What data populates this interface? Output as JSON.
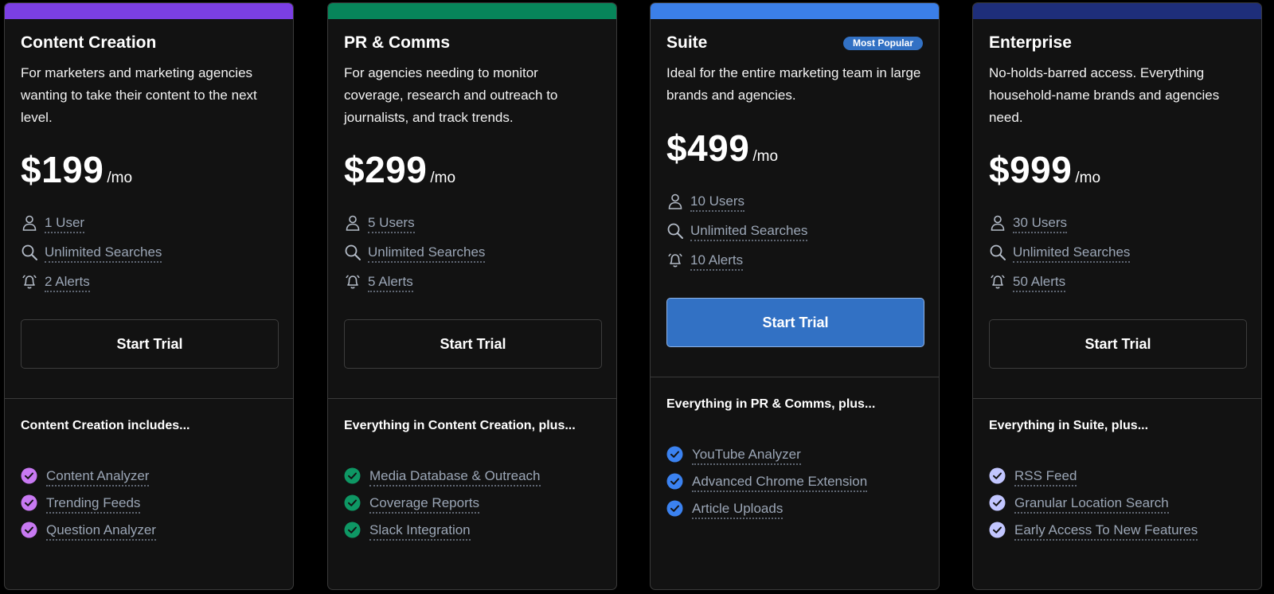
{
  "plans": [
    {
      "id": "content-creation",
      "name": "Content Creation",
      "accent": "#7b3fe4",
      "badge": "",
      "description": "For marketers and marketing agencies wanting to take their content to the next level.",
      "price": "$199",
      "period": "/mo",
      "features": [
        {
          "icon": "user-icon",
          "label": "1 User"
        },
        {
          "icon": "search-icon",
          "label": "Unlimited Searches"
        },
        {
          "icon": "bell-icon",
          "label": "2 Alerts"
        }
      ],
      "cta": "Start Trial",
      "includes_heading": "Content Creation includes...",
      "check_color": "#c879f2",
      "includes": [
        "Content Analyzer",
        "Trending Feeds",
        "Question Analyzer"
      ]
    },
    {
      "id": "pr-comms",
      "name": "PR & Comms",
      "accent": "#07855a",
      "badge": "",
      "description": "For agencies needing to monitor coverage, research and outreach to journalists, and track trends.",
      "price": "$299",
      "period": "/mo",
      "features": [
        {
          "icon": "user-icon",
          "label": "5 Users"
        },
        {
          "icon": "search-icon",
          "label": "Unlimited Searches"
        },
        {
          "icon": "bell-icon",
          "label": "5 Alerts"
        }
      ],
      "cta": "Start Trial",
      "includes_heading": "Everything in Content Creation, plus...",
      "check_color": "#0e9764",
      "includes": [
        "Media Database & Outreach",
        "Coverage Reports",
        "Slack Integration"
      ]
    },
    {
      "id": "suite",
      "name": "Suite",
      "accent": "#3b7fe8",
      "badge": "Most Popular",
      "badge_color": "#3271c4",
      "description": "Ideal for the entire marketing team in large brands and agencies.",
      "price": "$499",
      "period": "/mo",
      "features": [
        {
          "icon": "user-icon",
          "label": "10 Users"
        },
        {
          "icon": "search-icon",
          "label": "Unlimited Searches"
        },
        {
          "icon": "bell-icon",
          "label": "10 Alerts"
        }
      ],
      "cta": "Start Trial",
      "cta_primary": true,
      "includes_heading": "Everything in PR & Comms, plus...",
      "check_color": "#3b82f0",
      "includes": [
        "YouTube Analyzer",
        "Advanced Chrome Extension",
        "Article Uploads"
      ]
    },
    {
      "id": "enterprise",
      "name": "Enterprise",
      "accent": "#1e2e7a",
      "badge": "",
      "description": "No-holds-barred access. Everything household-name brands and agencies need.",
      "price": "$999",
      "period": "/mo",
      "features": [
        {
          "icon": "user-icon",
          "label": "30 Users"
        },
        {
          "icon": "search-icon",
          "label": "Unlimited Searches"
        },
        {
          "icon": "bell-icon",
          "label": "50 Alerts"
        }
      ],
      "cta": "Start Trial",
      "includes_heading": "Everything in Suite, plus...",
      "check_color": "#c2c6ff",
      "includes": [
        "RSS Feed",
        "Granular Location Search",
        "Early Access To New Features"
      ]
    }
  ]
}
